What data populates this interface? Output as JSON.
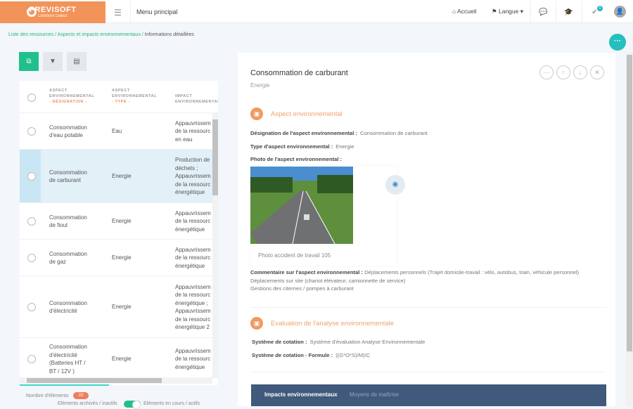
{
  "header": {
    "brand": "PREVISOFT",
    "brand_sub": "Lefebvre Dalloz",
    "menu_title": "Menu principal",
    "home": "Accueil",
    "language": "Langue",
    "notification_count": "0"
  },
  "breadcrumb": {
    "items": [
      "Liste des ressources",
      "Aspects et impacts environnementaux"
    ],
    "current": "Informations détaillées"
  },
  "table": {
    "headers": [
      {
        "line1": "ASPECT",
        "line2": "ENVIRONNEMENTAL",
        "line3": "- DÉSIGNATION ↓"
      },
      {
        "line1": "ASPECT",
        "line2": "ENVIRONNEMENTAL",
        "line3": "- TYPE ↓"
      },
      {
        "line1": "IMPACT",
        "line2": "ENVIRONNEMENTAL"
      }
    ],
    "rows": [
      {
        "designation": [
          "Consommation",
          "d'eau potable"
        ],
        "type": "Eau",
        "impact": [
          "Appauvrissem",
          "de la ressourc",
          "en eau"
        ]
      },
      {
        "designation": [
          "Consommation",
          "de carburant"
        ],
        "type": "Energie",
        "impact": [
          "Production de",
          "déchets ;",
          "Appauvrissem",
          "de la ressourc",
          "énergétique"
        ],
        "selected": true
      },
      {
        "designation": [
          "Consommation",
          "de fioul"
        ],
        "type": "Energie",
        "impact": [
          "Appauvrissem",
          "de la ressourc",
          "énergétique"
        ]
      },
      {
        "designation": [
          "Consommation",
          "de gaz"
        ],
        "type": "Energie",
        "impact": [
          "Appauvrissem",
          "de la ressourc",
          "énergétique"
        ]
      },
      {
        "designation": [
          "Consommation",
          "d'électricité"
        ],
        "type": "Energie",
        "impact": [
          "Appauvrissem",
          "de la ressourc",
          "énergétique ;",
          "Appauvrissem",
          "de la ressourc",
          "énergétique 2"
        ]
      },
      {
        "designation": [
          "Consommation",
          "d'électricité",
          "(Batteries HT /",
          "BT / 12V )"
        ],
        "type": "Energie",
        "impact": [
          "Appauvrissem",
          "de la ressourc",
          "énergétique"
        ]
      }
    ],
    "count_label": "Nombre d'éléments",
    "count": "20",
    "archived_label": "Eléments archivés / inactifs",
    "active_label": "Eléments en cours / actifs"
  },
  "detail": {
    "title": "Consommation de carburant",
    "subtitle": "Energie",
    "section1": {
      "title": "Aspect environnemental",
      "designation_label": "Désignation de l'aspect environnemental :",
      "designation": "Consommation de carburant",
      "type_label": "Type d'aspect environnemental :",
      "type": "Energie",
      "photo_label": "Photo de l'aspect environnemental :",
      "photo_caption": "Photo accident de travail 105",
      "comment_label": "Commentaire sur l'aspect environnemental :",
      "comment": [
        "Déplacements personnels (Trajet domicile-travail : vélo, autobus, train, véhicule personnel)",
        "Déplacements sur site (chariot élévateur, camionnette de service)",
        "Gestions des citernes / pompes à carburant"
      ]
    },
    "section2": {
      "title": "Evaluation de l'analyse environnementale",
      "system_label": "Système de cotation :",
      "system": "Système d'évaluation Analyse Environnementale",
      "formula_label": "Système de cotation - Formule :",
      "formula": "((G*O*S)/M)/C"
    },
    "tabs": [
      "Impacts environnementaux",
      "Moyens de maîtrise"
    ]
  },
  "colors": {
    "brand": "#f2945a",
    "accent": "#21c08b",
    "teal": "#26bfbf",
    "tabs_bg": "#40597c"
  }
}
